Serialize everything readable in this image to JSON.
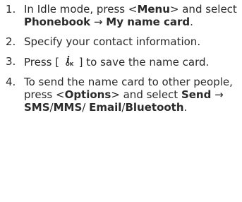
{
  "steps": [
    {
      "number": "1.",
      "parts": [
        "In Idle mode, press <",
        "Menu",
        "> and select ",
        "Phonebook",
        " → ",
        "My name card",
        "."
      ]
    },
    {
      "number": "2.",
      "parts": [
        "Specify your contact information."
      ]
    },
    {
      "number": "3.",
      "parts": [
        "Press [ ",
        " ] to save the name card."
      ],
      "key_icon": "confirm-key-icon",
      "key_icon_text": "OK"
    },
    {
      "number": "4.",
      "parts": [
        "To send the name card to other people, press <",
        "Options",
        "> and select ",
        "Send",
        " → ",
        "SMS",
        "/",
        "MMS",
        "/ ",
        "Email",
        "/",
        "Bluetooth",
        "."
      ]
    }
  ]
}
